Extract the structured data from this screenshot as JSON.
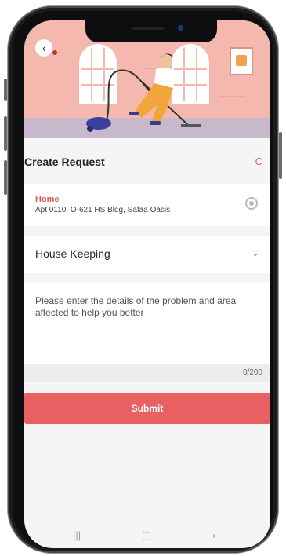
{
  "header": {
    "back_icon": "chevron-left-icon",
    "back_glyph": "‹"
  },
  "page": {
    "title": "Create Request",
    "refresh_icon": "refresh-icon",
    "refresh_glyph": "C"
  },
  "address": {
    "label": "Home",
    "value": "Apt 0110, O-621 HS Bldg, Safaa Oasis",
    "icon": "location-target-icon"
  },
  "service": {
    "selected": "House Keeping",
    "icon": "chevron-down-icon",
    "glyph": "⌄"
  },
  "details": {
    "placeholder": "Please enter the details of the problem and area affected to help you better",
    "counter": "0/200"
  },
  "submit": {
    "label": "Submit"
  },
  "navbar": {
    "recents_glyph": "|||",
    "home_glyph": "▢",
    "back_glyph": "‹"
  },
  "colors": {
    "accent": "#e96062",
    "hero_bg": "#f4b8ae",
    "address_label": "#d95a5a"
  }
}
